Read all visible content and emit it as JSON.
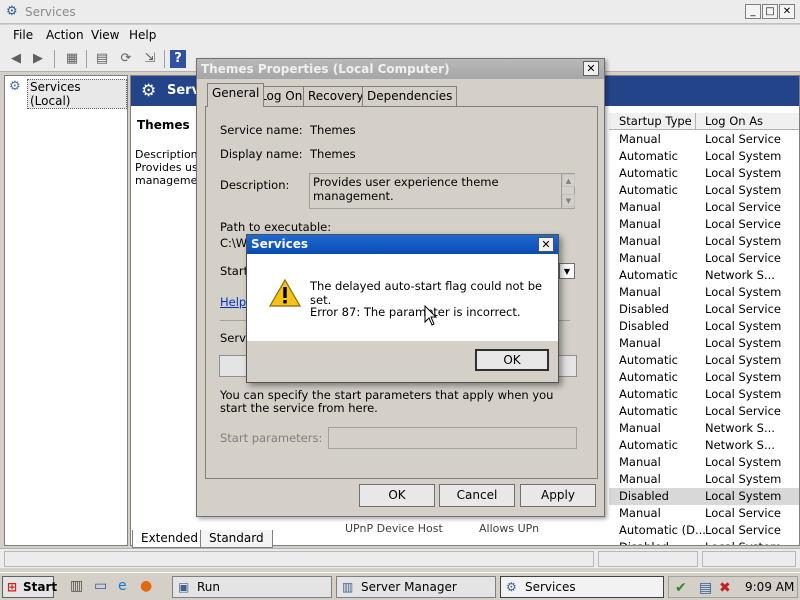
{
  "main_window": {
    "title": "Services",
    "controls": [
      "_",
      "□",
      "✕"
    ],
    "menu": [
      "File",
      "Action",
      "View",
      "Help"
    ]
  },
  "tree": {
    "root_label": "Services (Local)"
  },
  "right_pane": {
    "banner_title": "Servi",
    "detail_title": "Themes",
    "detail_lines": [
      "Description:",
      "Provides use",
      "management"
    ],
    "columns": {
      "startup_type": "Startup Type",
      "log_on_as": "Log On As"
    },
    "rows": [
      {
        "startup": "Manual",
        "logon": "Local Service"
      },
      {
        "startup": "Automatic",
        "logon": "Local System"
      },
      {
        "startup": "Automatic",
        "logon": "Local System"
      },
      {
        "startup": "Automatic",
        "logon": "Local System"
      },
      {
        "startup": "Manual",
        "logon": "Local Service"
      },
      {
        "startup": "Manual",
        "logon": "Local Service"
      },
      {
        "startup": "Manual",
        "logon": "Local System"
      },
      {
        "startup": "Manual",
        "logon": "Local Service"
      },
      {
        "startup": "Automatic",
        "logon": "Network S..."
      },
      {
        "startup": "Manual",
        "logon": "Local System"
      },
      {
        "startup": "Disabled",
        "logon": "Local Service"
      },
      {
        "startup": "Disabled",
        "logon": "Local System"
      },
      {
        "startup": "Manual",
        "logon": "Local System"
      },
      {
        "startup": "Automatic",
        "logon": "Local System"
      },
      {
        "startup": "Automatic",
        "logon": "Local System"
      },
      {
        "startup": "Automatic",
        "logon": "Local System"
      },
      {
        "startup": "Automatic",
        "logon": "Local Service"
      },
      {
        "startup": "Manual",
        "logon": "Network S..."
      },
      {
        "startup": "Automatic",
        "logon": "Network S..."
      },
      {
        "startup": "Manual",
        "logon": "Local System"
      },
      {
        "startup": "Manual",
        "logon": "Local System"
      },
      {
        "startup": "Disabled",
        "logon": "Local System"
      },
      {
        "startup": "Manual",
        "logon": "Local Service"
      },
      {
        "startup": "Automatic (D...",
        "logon": "Local Service"
      },
      {
        "startup": "Disabled",
        "logon": "Local System"
      }
    ],
    "selected_row_index": 21,
    "partial_row": {
      "name": "UPnP Device Host",
      "description": "Allows UPn",
      "startup": "Manual",
      "logon": "Local Service"
    }
  },
  "bottom_tabs": [
    "Extended",
    "Standard"
  ],
  "properties_dialog": {
    "title": "Themes Properties (Local Computer)",
    "tabs": [
      "General",
      "Log On",
      "Recovery",
      "Dependencies"
    ],
    "service_name_label": "Service name:",
    "service_name_value": "Themes",
    "display_name_label": "Display name:",
    "display_name_value": "Themes",
    "description_label": "Description:",
    "description_value": "Provides user experience theme management.",
    "path_label": "Path to executable:",
    "path_value_partial": "C:\\Wi",
    "startup_label_partial": "Startu",
    "help_link_partial": "Help r",
    "service_status_partial": "Servic",
    "start_params_note": "You can specify the start parameters that apply when you start the service from here.",
    "start_params_label": "Start parameters:",
    "buttons": {
      "ok": "OK",
      "cancel": "Cancel",
      "apply": "Apply"
    }
  },
  "message_box": {
    "title": "Services",
    "line1": "The delayed auto-start flag could not be set.",
    "line2": "Error 87: The parameter is incorrect.",
    "ok_label": "OK"
  },
  "taskbar": {
    "start_label": "Start",
    "tasks": [
      "Run",
      "Server Manager",
      "Services"
    ],
    "active_task": "Services",
    "clock": "9:09 AM"
  }
}
